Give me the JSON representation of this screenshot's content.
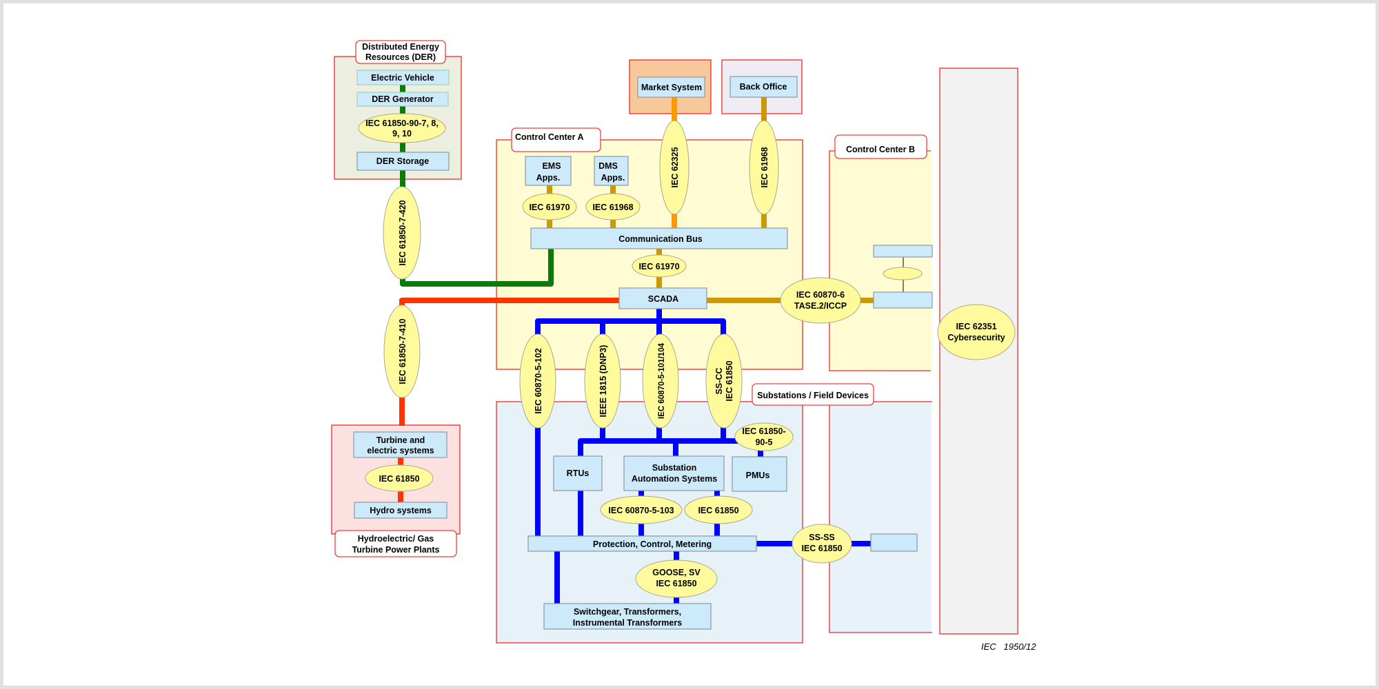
{
  "colors": {
    "der_link": "#0a7a0a",
    "hydro_link": "#ff3300",
    "market_link": "#ff9900",
    "control_link": "#cc9900",
    "substation_link": "#0000ff",
    "box_fill": "#cdeafb",
    "standard_fill": "#fffb9c",
    "region_border": "#f02828"
  },
  "regions": {
    "der": {
      "title": [
        "Distributed Energy",
        "Resources (DER)"
      ]
    },
    "control_a": {
      "title": "Control Center A"
    },
    "control_b": {
      "title": "Control Center B"
    },
    "substations": {
      "title": "Substations / Field Devices"
    },
    "hydro": {
      "title": [
        "Hydroelectric/ Gas",
        "Turbine Power Plants"
      ]
    }
  },
  "boxes": {
    "electric_vehicle": "Electric Vehicle",
    "der_generator": "DER Generator",
    "der_storage": "DER Storage",
    "market_system": "Market System",
    "back_office": "Back Office",
    "ems_apps": [
      "EMS",
      "Apps."
    ],
    "dms_apps": [
      "DMS",
      "Apps."
    ],
    "communication_bus": "Communication Bus",
    "scada": "SCADA",
    "turbine": [
      "Turbine and",
      "electric systems"
    ],
    "hydro_systems": "Hydro systems",
    "rtus": "RTUs",
    "sas": [
      "Substation",
      "Automation Systems"
    ],
    "pmus": "PMUs",
    "pcm": "Protection, Control, Metering",
    "switchgear": [
      "Switchgear, Transformers,",
      "Instrumental Transformers"
    ]
  },
  "standards": {
    "der_internal": [
      "IEC 61850-90-7, 8,",
      "9, 10"
    ],
    "der_link": "IEC 61850-7-420",
    "hydro_link": "IEC 61850-7-410",
    "hydro_internal": "IEC 61850",
    "market": "IEC 62325",
    "back_office": "IEC 61968",
    "ems": "IEC 61970",
    "dms": "IEC 61968",
    "bus_scada": "IEC 61970",
    "iccp": [
      "IEC 60870-6",
      "TASE.2/ICCP"
    ],
    "cyber": [
      "IEC 62351",
      "Cybersecurity"
    ],
    "s102": "IEC 60870-5-102",
    "dnp3": "IEEE 1815 (DNP3)",
    "s101": "IEC 60870-5-101/104",
    "sscc": [
      "SS-CC",
      "IEC 61850"
    ],
    "s905": [
      "IEC 61850-",
      "90-5"
    ],
    "s103": "IEC 60870-5-103",
    "sas61850": "IEC 61850",
    "goose": [
      "GOOSE, SV",
      "IEC 61850"
    ],
    "ssss": [
      "SS-SS",
      "IEC 61850"
    ]
  },
  "footer": {
    "figure_id": "IEC   1950/12"
  }
}
